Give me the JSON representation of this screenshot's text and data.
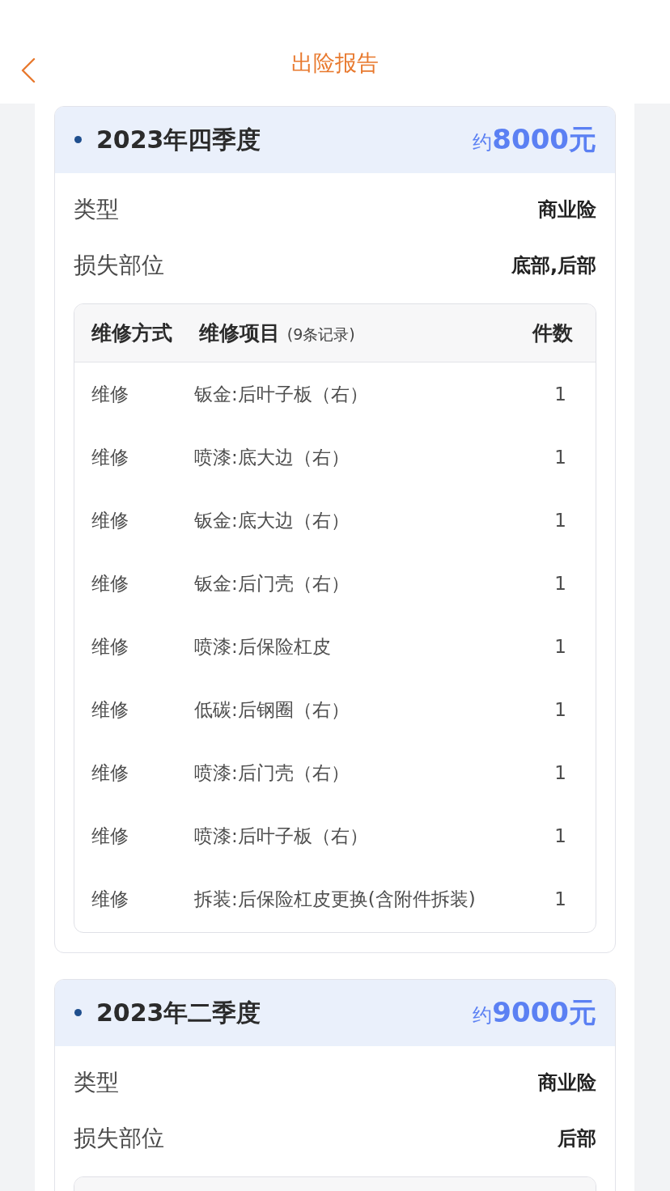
{
  "header": {
    "title": "出险报告"
  },
  "cards": [
    {
      "title": "2023年四季度",
      "amount_prefix": "约",
      "amount": "8000元",
      "fields": [
        {
          "label": "类型",
          "value": "商业险"
        },
        {
          "label": "损失部位",
          "value": "底部,后部"
        }
      ],
      "table": {
        "columns": [
          "维修方式",
          "维修项目",
          "件数"
        ],
        "record_count": "(9条记录)",
        "rows": [
          {
            "method": "维修",
            "item": "钣金:后叶子板（右）",
            "count": "1"
          },
          {
            "method": "维修",
            "item": "喷漆:底大边（右）",
            "count": "1"
          },
          {
            "method": "维修",
            "item": "钣金:底大边（右）",
            "count": "1"
          },
          {
            "method": "维修",
            "item": "钣金:后门壳（右）",
            "count": "1"
          },
          {
            "method": "维修",
            "item": "喷漆:后保险杠皮",
            "count": "1"
          },
          {
            "method": "维修",
            "item": "低碳:后钢圈（右）",
            "count": "1"
          },
          {
            "method": "维修",
            "item": "喷漆:后门壳（右）",
            "count": "1"
          },
          {
            "method": "维修",
            "item": "喷漆:后叶子板（右）",
            "count": "1"
          },
          {
            "method": "维修",
            "item": "拆装:后保险杠皮更换(含附件拆装)",
            "count": "1"
          }
        ]
      }
    },
    {
      "title": "2023年二季度",
      "amount_prefix": "约",
      "amount": "9000元",
      "fields": [
        {
          "label": "类型",
          "value": "商业险"
        },
        {
          "label": "损失部位",
          "value": "后部"
        }
      ]
    }
  ]
}
